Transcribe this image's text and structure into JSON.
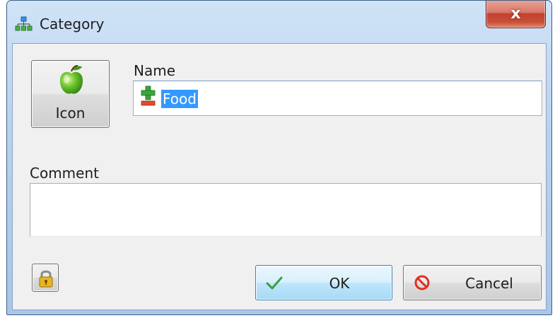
{
  "window": {
    "title": "Category",
    "close_label": "x"
  },
  "icon_button": {
    "label": "Icon",
    "icon": "apple-icon"
  },
  "name_field": {
    "label": "Name",
    "value": "Food",
    "icon": "plus-minus-icon"
  },
  "comment_field": {
    "label": "Comment",
    "value": ""
  },
  "buttons": {
    "lock_icon": "padlock-icon",
    "ok_label": "OK",
    "ok_icon": "checkmark-icon",
    "cancel_label": "Cancel",
    "cancel_icon": "no-entry-icon"
  },
  "colors": {
    "titlebar": "#b9d2ee",
    "selection": "#3399ff",
    "close_button": "#c3412d",
    "dialog_background": "#f0f0f0"
  }
}
